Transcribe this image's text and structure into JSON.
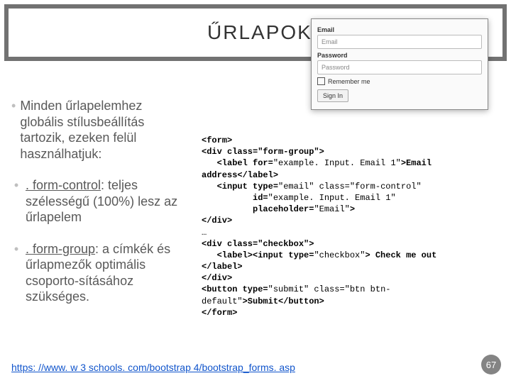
{
  "title": "ŰRLAPOK",
  "preview": {
    "email_label": "Email",
    "email_placeholder": "Email",
    "password_label": "Password",
    "password_placeholder": "Password",
    "remember_label": "Remember me",
    "signin_label": "Sign In"
  },
  "left": {
    "intro": "Minden űrlapelemhez globális stílusbeállítás tartozik, ezeken felül használhatjuk:",
    "sub1_code": ". form-control",
    "sub1_rest": ": teljes szélességű (100%) lesz az űrlapelem",
    "sub2_code": ". form-group",
    "sub2_rest": ": a címkék és űrlapmezők optimális csoporto-sításához szükséges."
  },
  "code": {
    "l1": "<form>",
    "l2": "<div class=\"form-group\">",
    "l3_a": "   <label for=",
    "l3_b": "\"example. Input. Email 1\"",
    "l3_c": ">Email",
    "l4": "address</label>",
    "l5_a": "   <input type=",
    "l5_b": "\"email\" class=",
    "l5_c": "\"form-control\"",
    "l6_a": "          id=",
    "l6_b": "\"example. Input. Email 1\"",
    "l7_a": "          placeholder=",
    "l7_b": "\"Email\"",
    "l7_c": ">",
    "l8": "</div>",
    "l9": "…",
    "l10": "<div class=\"checkbox\">",
    "l11_a": "   <label><input type=",
    "l11_b": "\"checkbox\"",
    "l11_c": "> Check me out",
    "l12": "</label>",
    "l13": "</div>",
    "l14_a": "<button type=",
    "l14_b": "\"submit\" class=",
    "l14_c": "\"btn btn-",
    "l15_a": "default\"",
    "l15_b": ">Submit</button>",
    "l16": "</form>"
  },
  "footer": {
    "link": "https: //www. w 3 schools. com/bootstrap 4/bootstrap_forms. asp",
    "page": "67"
  }
}
